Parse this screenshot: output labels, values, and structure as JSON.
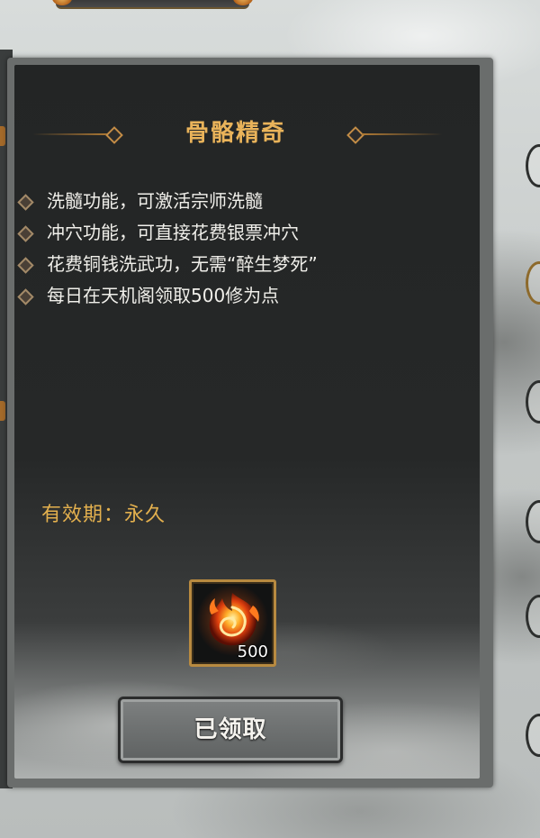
{
  "card": {
    "title": "骨骼精奇",
    "features": [
      "洗髓功能，可激活宗师洗髓",
      "冲穴功能，可直接花费银票冲穴",
      "花费铜钱洗武功，无需“醉生梦死”",
      "每日在天机阁领取500修为点"
    ],
    "validity": "有效期：永久",
    "reward": {
      "icon": "fire-orb-icon",
      "count": "500"
    },
    "claim_button_label": "已领取",
    "claimed": true
  },
  "colors": {
    "title_gold": "#e9b35a",
    "validity_gold": "#e3b04e",
    "panel_dark": "#232525",
    "frame_gold": "#b88a40",
    "button_gray": "#6f7272"
  }
}
